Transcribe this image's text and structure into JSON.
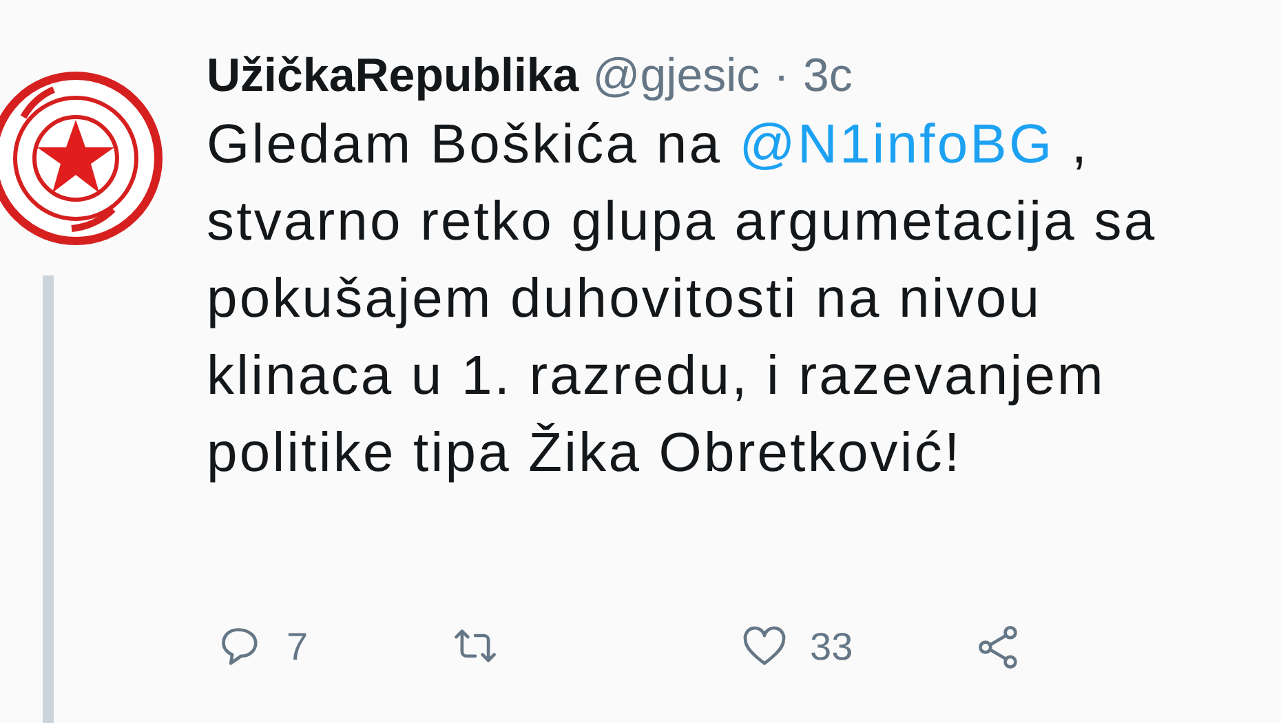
{
  "tweet": {
    "display_name": "UžičkaRepublika",
    "handle": "@gjesic",
    "separator": "·",
    "time": "3c",
    "avatar": {
      "kind": "picture"
    },
    "lines": [
      [
        {
          "kind": "plain",
          "text": "Gledam Boškića na "
        },
        {
          "kind": "mention",
          "text": "@N1infoBG"
        },
        {
          "kind": "plain",
          "text": " ,"
        }
      ],
      [
        {
          "kind": "plain",
          "text": "stvarno retko glupa argumetacija sa"
        }
      ],
      [
        {
          "kind": "plain",
          "text": "pokušajem duhovitosti na nivou"
        }
      ],
      [
        {
          "kind": "plain",
          "text": "klinaca u 1. razredu, i razevanjem"
        }
      ],
      [
        {
          "kind": "plain",
          "text": "politike tipa Žika Obretković!"
        }
      ]
    ],
    "actions": [
      {
        "kind": "reply",
        "count": "7"
      },
      {
        "kind": "retweet"
      },
      {
        "kind": "like",
        "count": "33"
      },
      {
        "kind": "share"
      }
    ]
  }
}
